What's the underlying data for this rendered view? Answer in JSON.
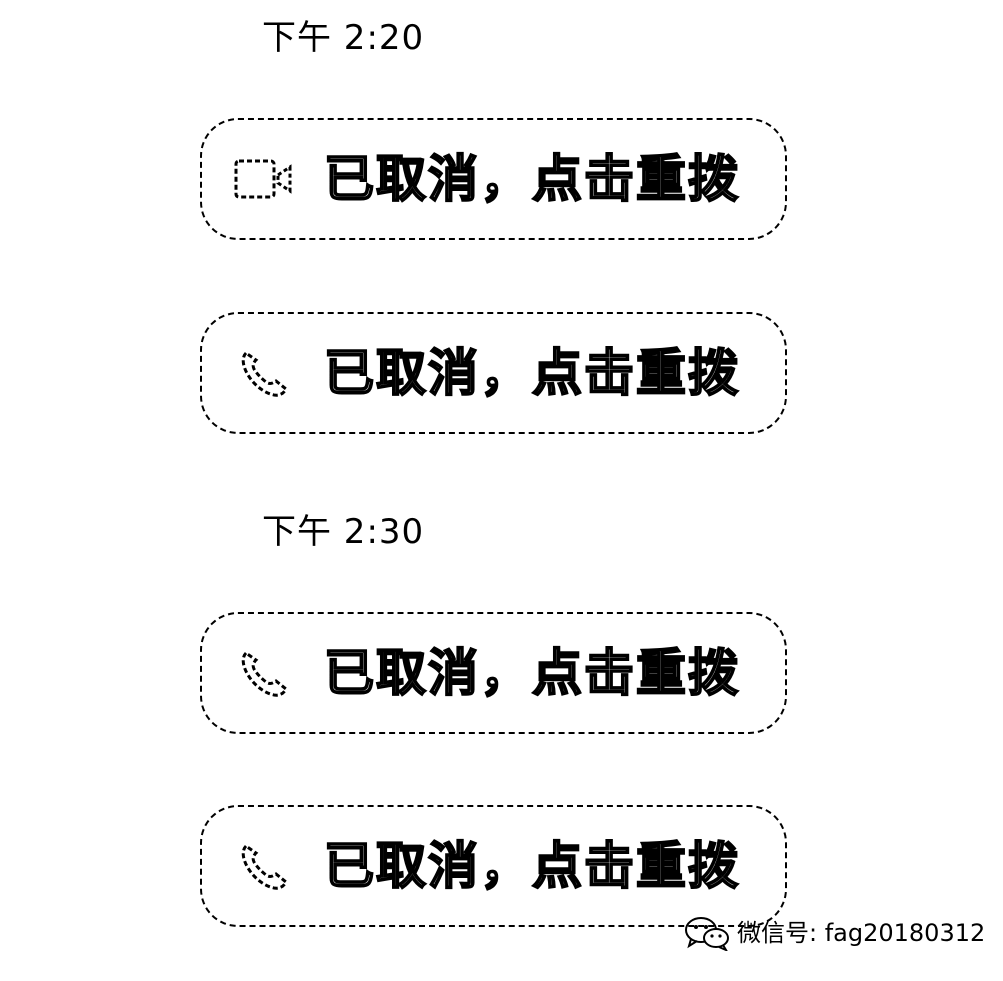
{
  "messages": [
    {
      "timestamp": "下午 2:20",
      "calls": [
        {
          "icon": "video-call-icon",
          "text": "已取消，点击重拨"
        },
        {
          "icon": "phone-icon",
          "text": "已取消，点击重拨"
        }
      ]
    },
    {
      "timestamp": "下午 2:30",
      "calls": [
        {
          "icon": "phone-icon",
          "text": "已取消，点击重拨"
        },
        {
          "icon": "phone-icon",
          "text": "已取消，点击重拨"
        }
      ]
    }
  ],
  "watermark": {
    "icon": "wechat-icon",
    "text": "微信号: fag20180312"
  }
}
